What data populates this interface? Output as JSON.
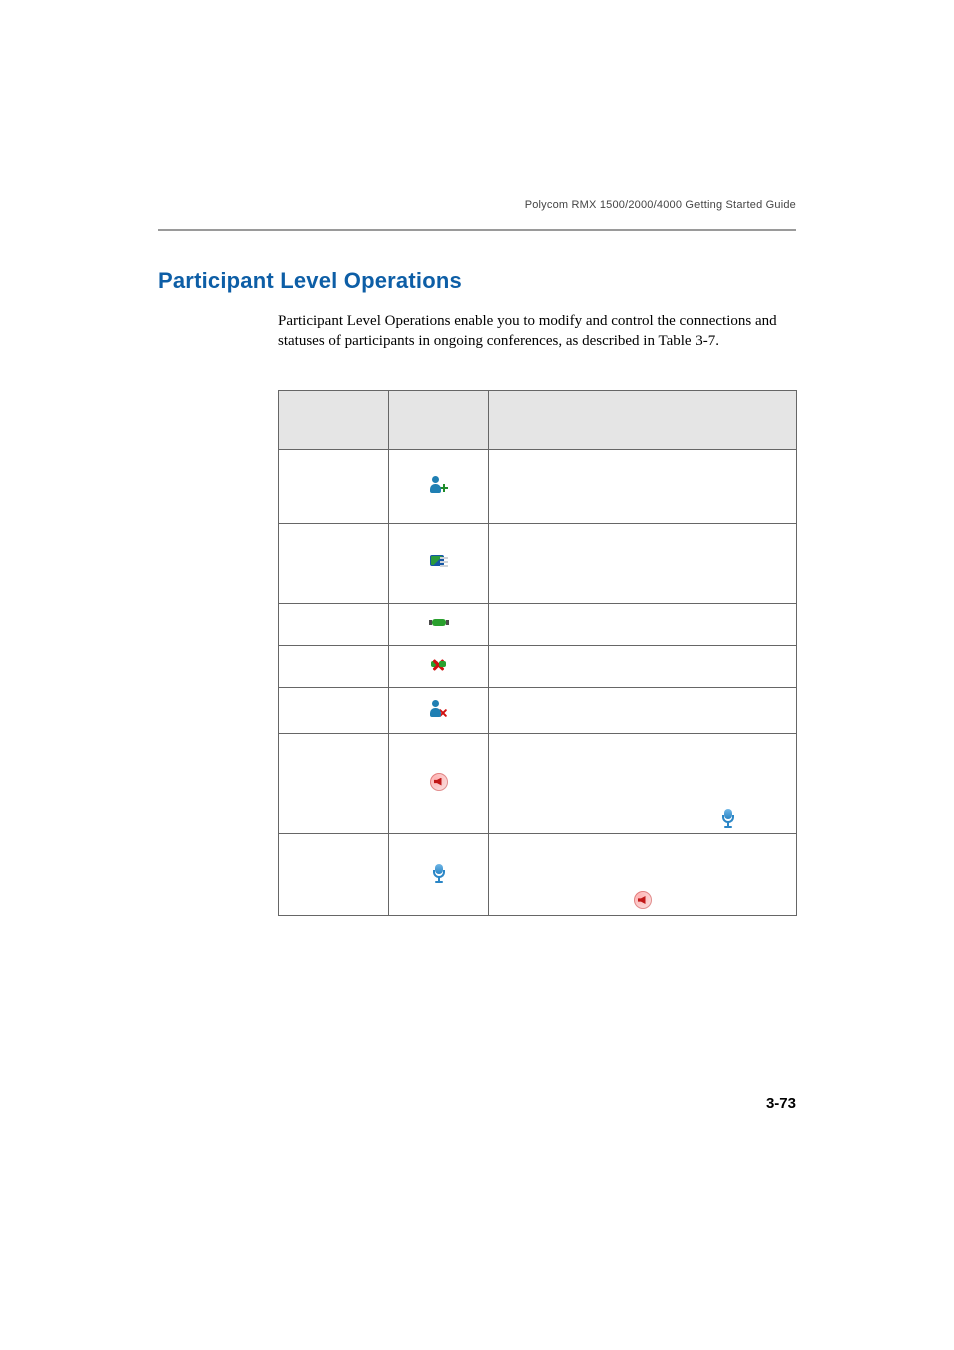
{
  "running_head": "Polycom RMX 1500/2000/4000 Getting Started Guide",
  "heading": "Participant Level Operations",
  "intro": "Participant Level Operations enable you to modify and control the connections and statuses of participants in ongoing conferences, as described in Table 3-7.",
  "page_number": "3-73",
  "table": {
    "headers": {
      "col1": "",
      "col2": "",
      "col3": ""
    },
    "rows": [
      {
        "icon": "person-plus",
        "label": "",
        "desc": ""
      },
      {
        "icon": "details",
        "label": "",
        "desc": ""
      },
      {
        "icon": "connect",
        "label": "",
        "desc": ""
      },
      {
        "icon": "disconnect",
        "label": "",
        "desc": ""
      },
      {
        "icon": "person-x",
        "label": "",
        "desc": ""
      },
      {
        "icon": "mute",
        "label": "",
        "desc": "",
        "inline_icon": "unmute"
      },
      {
        "icon": "unmute",
        "label": "",
        "desc": "",
        "inline_icon": "mute"
      }
    ]
  }
}
